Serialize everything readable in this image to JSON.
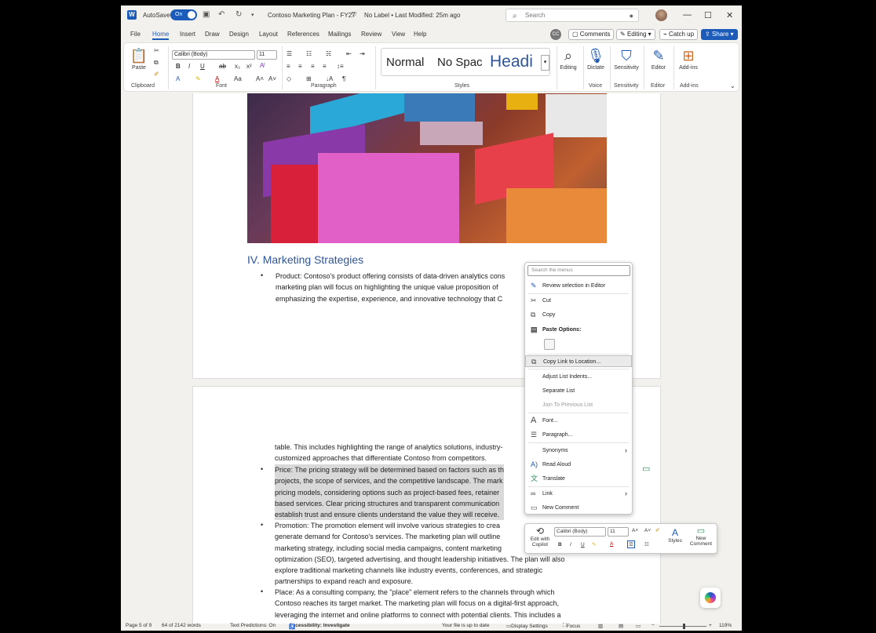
{
  "titlebar": {
    "autosave_label": "AutoSave",
    "autosave_state": "On",
    "doc_title": "Contoso Marketing Plan - FY27",
    "label_info": "No Label • Last Modified: 25m ago",
    "search_placeholder": "Search"
  },
  "menu_tabs": [
    "File",
    "Home",
    "Insert",
    "Draw",
    "Design",
    "Layout",
    "References",
    "Mailings",
    "Review",
    "View",
    "Help"
  ],
  "active_tab": "Home",
  "tab_actions": {
    "comments": "Comments",
    "editing": "Editing",
    "catch_up": "Catch up",
    "share": "Share"
  },
  "ribbon": {
    "paste": "Paste",
    "font_name": "Calibri (Body)",
    "font_size": "11",
    "styles": [
      "Normal",
      "No Spac",
      "Headi"
    ],
    "editing": "Editing",
    "dictate": "Dictate",
    "sensitivity": "Sensitivity",
    "editor": "Editor",
    "add_ins": "Add-ins",
    "groups": {
      "clipboard": "Clipboard",
      "font": "Font",
      "paragraph": "Paragraph",
      "styles": "Styles",
      "voice": "Voice",
      "sensitivity": "Sensitivity",
      "editor": "Editor",
      "add_ins": "Add-ins"
    }
  },
  "document": {
    "heading": "IV. Marketing Strategies",
    "page1_lines": [
      "Product: Contoso's product offering consists of data-driven analytics cons",
      "marketing plan will focus on highlighting the unique value proposition of",
      "emphasizing the expertise, experience, and innovative technology that C"
    ],
    "page2_lines_intro": [
      "table. This includes highlighting the range of analytics solutions, industry-",
      "customized approaches that differentiate Contoso from competitors."
    ],
    "price_lines": [
      "Price: The pricing strategy will be determined based on factors such as th",
      "projects, the scope of services, and the competitive landscape. The mark",
      "pricing models, considering options such as project-based fees, retainer",
      "based services. Clear pricing structures and transparent communication",
      "establish trust and ensure clients understand the value they will receive."
    ],
    "promotion_lines": [
      "Promotion: The promotion element will involve various strategies to crea",
      "generate demand for Contoso's services. The marketing plan will outline",
      "marketing strategy, including social media campaigns, content marketing",
      "optimization (SEO), targeted advertising, and thought leadership initiatives. The plan will also",
      "explore traditional marketing channels like industry events, conferences, and strategic",
      "partnerships to expand reach and exposure."
    ],
    "place_lines": [
      "Place: As a consulting company, the \"place\" element refers to the channels through which",
      "Contoso reaches its target market. The marketing plan will focus on a digital-first approach,",
      "leveraging the internet and online platforms to connect with potential clients. This includes a"
    ]
  },
  "context_menu": {
    "search_placeholder": "Search the menus",
    "items": {
      "review": "Review selection in Editor",
      "cut": "Cut",
      "copy": "Copy",
      "paste_options": "Paste Options:",
      "copy_link": "Copy Link to Location...",
      "adjust_indents": "Adjust List Indents...",
      "separate_list": "Separate List",
      "join_list": "Join To Previous List",
      "font": "Font...",
      "paragraph": "Paragraph...",
      "synonyms": "Synonyms",
      "read_aloud": "Read Aloud",
      "translate": "Translate",
      "link": "Link",
      "new_comment": "New Comment"
    }
  },
  "mini_toolbar": {
    "edit_with_copilot": "Edit with Copilot",
    "font_name": "Calibri (Body)",
    "font_size": "11",
    "styles": "Styles",
    "new_comment": "New Comment"
  },
  "statusbar": {
    "page": "Page 5 of 9",
    "words": "64 of 2142 words",
    "text_predictions": "Text Predictions: On",
    "accessibility": "Accessibility: Investigate",
    "file_status": "Your file is up to date",
    "display_settings": "Display Settings",
    "focus": "Focus",
    "zoom": "119%"
  }
}
